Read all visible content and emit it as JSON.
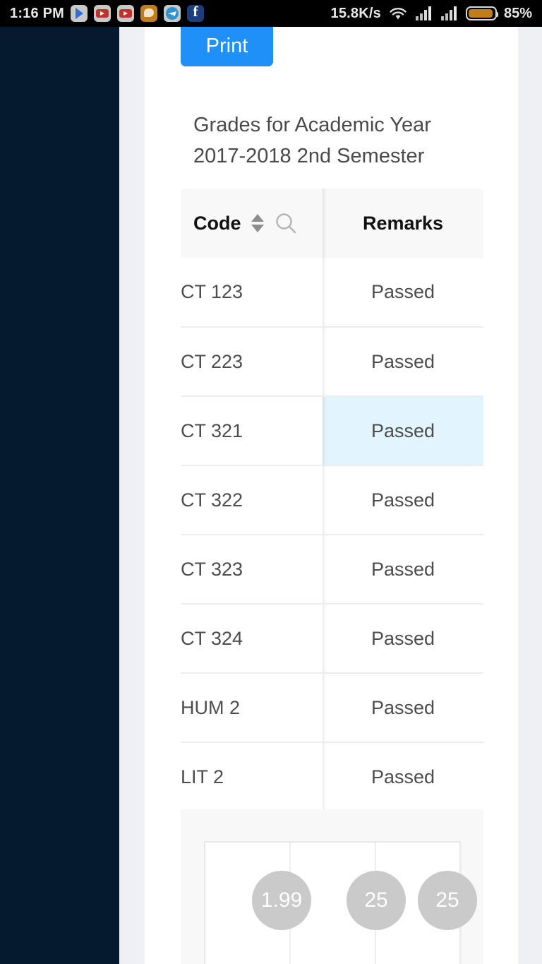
{
  "statusbar": {
    "clock": "1:16 PM",
    "network_speed": "15.8K/s",
    "battery_percent": "85%",
    "notification_icons": [
      "play-store-icon",
      "youtube-icon",
      "youtube-icon",
      "messenger-icon",
      "telegram-icon",
      "facebook-icon"
    ],
    "status_icons": [
      "wifi-icon",
      "signal-bars-icon",
      "signal-bars-icon",
      "battery-icon"
    ]
  },
  "page": {
    "print_label": "Print",
    "heading": "Grades for Academic Year 2017-2018 2nd Semester"
  },
  "table": {
    "columns": [
      {
        "label": "Code",
        "sortable": true,
        "searchable": true
      },
      {
        "label": "Remarks",
        "sortable": false,
        "searchable": false
      }
    ],
    "rows": [
      {
        "code": "CT 123",
        "remarks": "Passed",
        "highlighted": false
      },
      {
        "code": "CT 223",
        "remarks": "Passed",
        "highlighted": false
      },
      {
        "code": "CT 321",
        "remarks": "Passed",
        "highlighted": true
      },
      {
        "code": "CT 322",
        "remarks": "Passed",
        "highlighted": false
      },
      {
        "code": "CT 323",
        "remarks": "Passed",
        "highlighted": false
      },
      {
        "code": "CT 324",
        "remarks": "Passed",
        "highlighted": false
      },
      {
        "code": "HUM 2",
        "remarks": "Passed",
        "highlighted": false
      },
      {
        "code": "LIT 2",
        "remarks": "Passed",
        "highlighted": false
      }
    ]
  },
  "summary": {
    "bubbles": [
      {
        "value": "1.99"
      },
      {
        "value": "25"
      },
      {
        "value": "25"
      }
    ]
  },
  "colors": {
    "accent_blue": "#1e90f8",
    "sidebar_navy": "#061a2d",
    "highlight_row": "#e2f4fd",
    "bubble_gray": "#cacaca",
    "page_gutter": "#eef0f4"
  }
}
